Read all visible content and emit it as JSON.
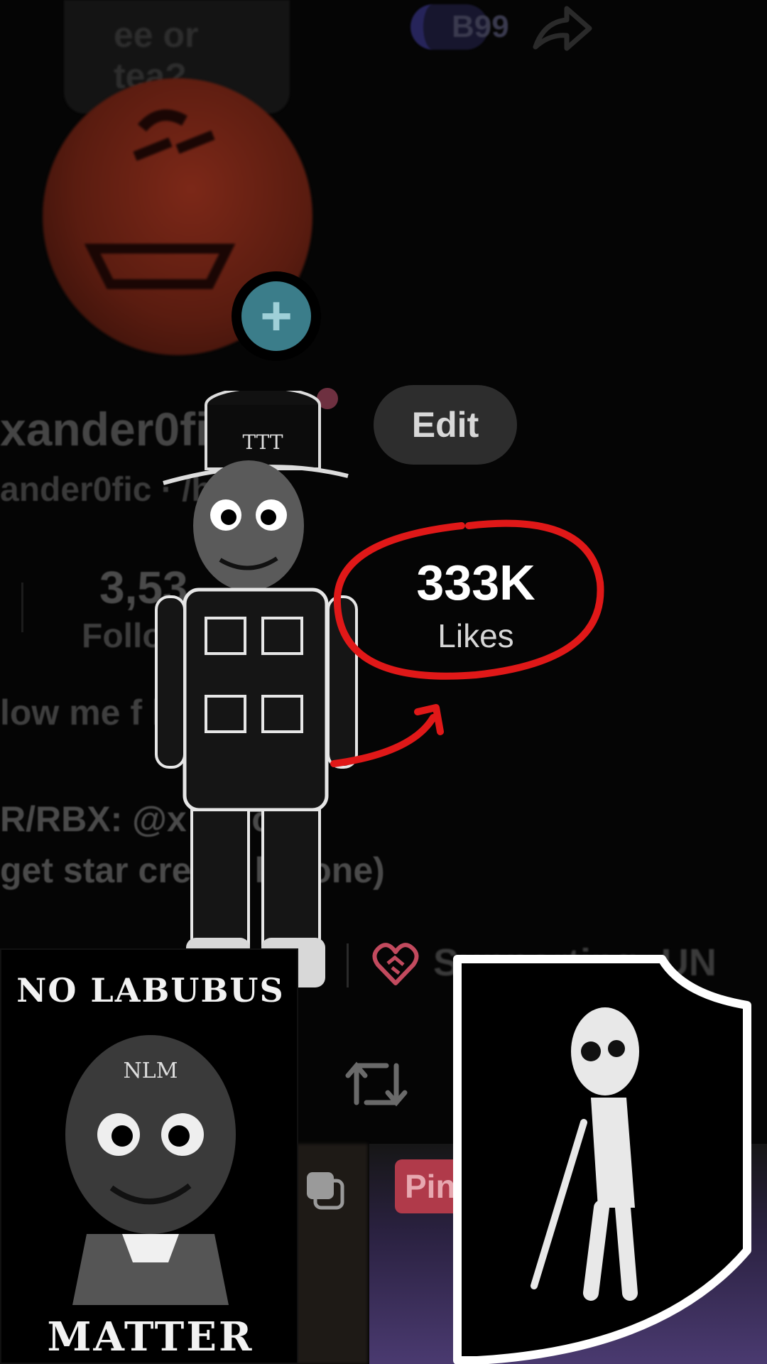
{
  "header": {
    "speech_bubble": "ee or\ntea?",
    "badge_text": "B99"
  },
  "profile": {
    "username": "xander0fic",
    "handle": "ander0fic · /his",
    "edit_label": "Edit",
    "following_count": "3,53",
    "following_label": "Follow",
    "likes_count": "333K",
    "likes_label": "Likes",
    "bio_line1": "low me f  kie",
    "bio_line2": "R/RBX: @x  r0fic",
    "bio_line3": "get star cre  on korone)",
    "supporting": "Supporting: UN"
  },
  "grid": {
    "pin_label": "Pin"
  },
  "stickers": {
    "meme_top": "NO LABUBUS",
    "meme_bottom": "MATTER",
    "meme_forehead": "NLM",
    "hat_text": "TTT"
  },
  "colors": {
    "annotation": "#e01818",
    "accent_plus": "#3b7d8a"
  },
  "icons": [
    "share-icon",
    "plus-icon",
    "heart-handshake-icon",
    "repost-icon",
    "copy-icon"
  ]
}
